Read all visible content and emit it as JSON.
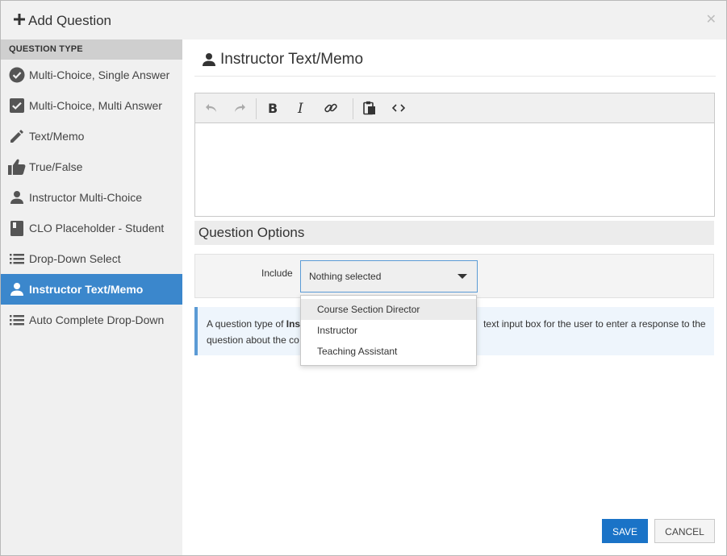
{
  "dialog": {
    "title": "Add Question",
    "close_icon": "close-icon"
  },
  "sidebar": {
    "header": "QUESTION TYPE",
    "items": [
      {
        "label": "Multi-Choice, Single Answer",
        "icon": "check-circle-icon"
      },
      {
        "label": "Multi-Choice, Multi Answer",
        "icon": "checkbox-icon"
      },
      {
        "label": "Text/Memo",
        "icon": "pencil-icon"
      },
      {
        "label": "True/False",
        "icon": "thumbs-up-icon"
      },
      {
        "label": "Instructor Multi-Choice",
        "icon": "person-icon"
      },
      {
        "label": "CLO Placeholder - Student",
        "icon": "book-icon"
      },
      {
        "label": "Drop-Down Select",
        "icon": "list-icon"
      },
      {
        "label": "Instructor Text/Memo",
        "icon": "person-icon",
        "active": true
      },
      {
        "label": "Auto Complete Drop-Down",
        "icon": "list-icon"
      }
    ]
  },
  "main": {
    "heading": "Instructor Text/Memo",
    "editor_toolbar": [
      "undo-icon",
      "redo-icon",
      "bold-icon",
      "italic-icon",
      "link-icon",
      "paste-icon",
      "code-icon"
    ],
    "options_title": "Question Options",
    "include_label": "Include",
    "include_value": "Nothing selected",
    "include_options": [
      "Course Section Director",
      "Instructor",
      "Teaching Assistant"
    ],
    "info_prefix": "A question type of ",
    "info_bold": "Inst",
    "info_line1_end": "text input box for the user to enter a response to the",
    "info_line2_start": "question about the co"
  },
  "buttons": {
    "save": "SAVE",
    "cancel": "CANCEL"
  },
  "colors": {
    "accent": "#3b87cc",
    "save": "#1a73c7",
    "info_border": "#5b9bd5"
  }
}
